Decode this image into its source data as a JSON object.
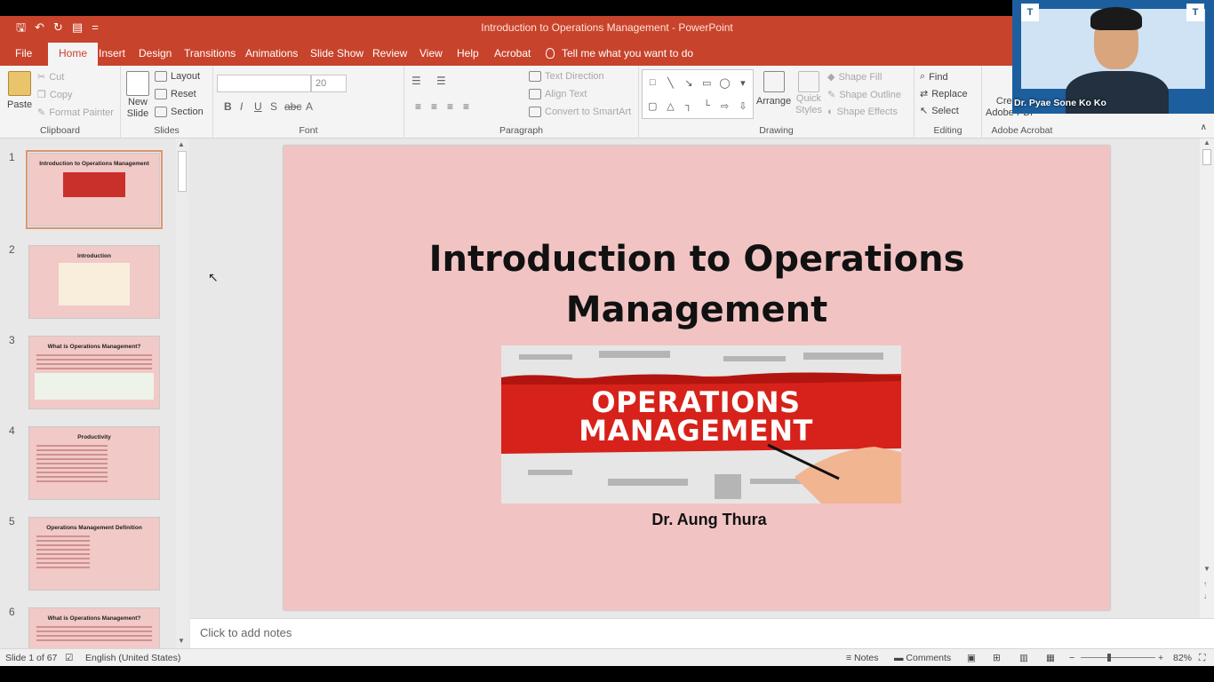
{
  "window": {
    "title": "Introduction to Operations Management  -  PowerPoint"
  },
  "qat": {
    "customize": "="
  },
  "tabs": [
    "File",
    "Home",
    "Insert",
    "Design",
    "Transitions",
    "Animations",
    "Slide Show",
    "Review",
    "View",
    "Help",
    "Acrobat"
  ],
  "tell_me": "Tell me what you want to do",
  "ribbon": {
    "clipboard": {
      "label": "Clipboard",
      "paste": "Paste",
      "cut": "Cut",
      "copy": "Copy",
      "format_painter": "Format Painter"
    },
    "slides": {
      "label": "Slides",
      "new_slide": "New",
      "new_slide_2": "Slide",
      "layout": "Layout",
      "reset": "Reset",
      "section": "Section"
    },
    "font": {
      "label": "Font",
      "size": "20"
    },
    "paragraph": {
      "label": "Paragraph",
      "text_direction": "Text Direction",
      "align_text": "Align Text",
      "convert_smartart": "Convert to SmartArt"
    },
    "drawing": {
      "label": "Drawing",
      "arrange": "Arrange",
      "quick_styles": "Quick",
      "quick_styles_2": "Styles",
      "shape_fill": "Shape Fill",
      "shape_outline": "Shape Outline",
      "shape_effects": "Shape Effects"
    },
    "editing": {
      "label": "Editing",
      "find": "Find",
      "replace": "Replace",
      "select": "Select"
    },
    "acrobat": {
      "label": "Adobe Acrobat",
      "create_pdf": "Create",
      "create_pdf_2": "Adobe PDF"
    }
  },
  "thumbnails": [
    {
      "num": "1",
      "title": "Introduction to Operations Management"
    },
    {
      "num": "2",
      "title": "Introduction"
    },
    {
      "num": "3",
      "title": "What is Operations Management?"
    },
    {
      "num": "4",
      "title": "Productivity"
    },
    {
      "num": "5",
      "title": "Operations Management Definition"
    },
    {
      "num": "6",
      "title": "What is Operations Management?"
    }
  ],
  "slide": {
    "title_line1": "Introduction to Operations",
    "title_line2": "Management",
    "image_text_1": "OPERATIONS",
    "image_text_2": "MANAGEMENT",
    "author": "Dr. Aung Thura"
  },
  "notes_placeholder": "Click to add notes",
  "status": {
    "slide_count": "Slide 1 of 67",
    "language": "English (United States)",
    "notes": "Notes",
    "comments": "Comments",
    "zoom": "82%"
  },
  "video": {
    "name": "Dr. Pyae Sone Ko Ko"
  },
  "colors": {
    "accent": "#c8432b",
    "slide_bg": "#f1c4c3"
  }
}
